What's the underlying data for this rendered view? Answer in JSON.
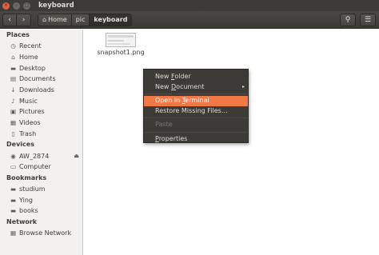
{
  "window": {
    "title": "keyboard",
    "close_glyph": "×",
    "min_glyph": "–",
    "max_glyph": "□"
  },
  "toolbar": {
    "back_glyph": "‹",
    "forward_glyph": "›",
    "breadcrumbs": [
      {
        "label": "Home",
        "icon": "home-icon"
      },
      {
        "label": "pic"
      },
      {
        "label": "keyboard",
        "active": true
      }
    ],
    "home_glyph": "⌂",
    "search_glyph": "⚲",
    "menu_glyph": "☰"
  },
  "sidebar": {
    "places_header": "Places",
    "places": [
      {
        "label": "Recent",
        "icon": "clock-icon",
        "glyph": "◷"
      },
      {
        "label": "Home",
        "icon": "home-icon",
        "glyph": "⌂"
      },
      {
        "label": "Desktop",
        "icon": "desktop-folder-icon",
        "glyph": "▬"
      },
      {
        "label": "Documents",
        "icon": "documents-folder-icon",
        "glyph": "▤"
      },
      {
        "label": "Downloads",
        "icon": "download-icon",
        "glyph": "↓"
      },
      {
        "label": "Music",
        "icon": "music-icon",
        "glyph": "♪"
      },
      {
        "label": "Pictures",
        "icon": "pictures-icon",
        "glyph": "▣"
      },
      {
        "label": "Videos",
        "icon": "videos-icon",
        "glyph": "▦"
      },
      {
        "label": "Trash",
        "icon": "trash-icon",
        "glyph": "▯"
      }
    ],
    "devices_header": "Devices",
    "devices": [
      {
        "label": "AW_2874",
        "icon": "disk-icon",
        "glyph": "◉",
        "eject_glyph": "⏏"
      },
      {
        "label": "Computer",
        "icon": "computer-icon",
        "glyph": "▭"
      }
    ],
    "bookmarks_header": "Bookmarks",
    "bookmarks": [
      {
        "label": "studium",
        "icon": "folder-icon",
        "glyph": "▬"
      },
      {
        "label": "Ying",
        "icon": "folder-icon",
        "glyph": "▬"
      },
      {
        "label": "books",
        "icon": "folder-icon",
        "glyph": "▬"
      }
    ],
    "network_header": "Network",
    "network": [
      {
        "label": "Browse Network",
        "icon": "network-icon",
        "glyph": "▦"
      }
    ]
  },
  "files": [
    {
      "name": "snapshot1.png",
      "icon": "image-thumbnail-icon"
    }
  ],
  "context_menu": {
    "new_folder": {
      "pre": "New ",
      "u": "F",
      "post": "older"
    },
    "new_document": {
      "pre": "New ",
      "u": "D",
      "post": "ocument",
      "arrow": "▸"
    },
    "open_terminal": {
      "pre": "Open in ",
      "u": "T",
      "post": "erminal"
    },
    "restore_missing": {
      "pre": "Restore Missing Files…",
      "u": "",
      "post": ""
    },
    "paste": {
      "pre": "Paste",
      "u": "",
      "post": ""
    },
    "properties": {
      "pre": "",
      "u": "P",
      "post": "roperties"
    }
  },
  "colors": {
    "titlebar": "#3c3b37",
    "accent": "#f07746",
    "close_button": "#e0613b",
    "sidebar_bg": "#f2f1f0"
  }
}
